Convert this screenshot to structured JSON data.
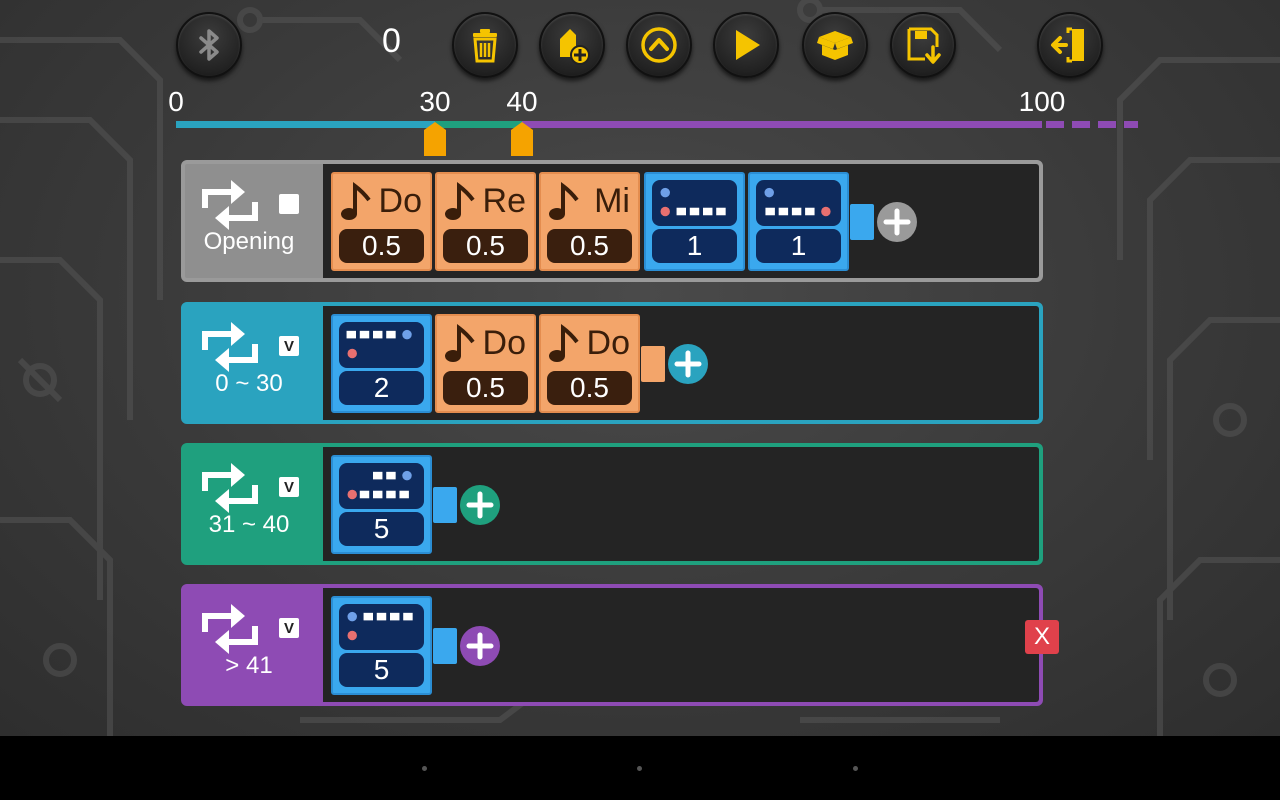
{
  "header": {
    "score": "0",
    "buttons": [
      {
        "name": "bluetooth-button",
        "icon": "bluetooth-icon"
      },
      {
        "name": "trash-button",
        "icon": "trash-icon"
      },
      {
        "name": "add-block-button",
        "icon": "add-block-icon"
      },
      {
        "name": "scroll-up-button",
        "icon": "chevron-up-icon"
      },
      {
        "name": "play-button",
        "icon": "play-icon"
      },
      {
        "name": "open-box-button",
        "icon": "open-box-icon"
      },
      {
        "name": "save-button",
        "icon": "save-icon"
      },
      {
        "name": "exit-button",
        "icon": "exit-door-icon"
      }
    ]
  },
  "scale": {
    "labels": [
      "0",
      "30",
      "40",
      "100"
    ],
    "thresholds": [
      30,
      40
    ],
    "max": 100
  },
  "colors": {
    "accent_yellow": "#f5c400",
    "opening": "#8f8f8f",
    "range1": "#2aa3bf",
    "range2": "#1fa07e",
    "range3": "#8e4bb4",
    "note": "#f3a56a",
    "motor": "#3aa8ee",
    "delete": "#e0414b"
  },
  "rows": [
    {
      "label": "Opening",
      "check": "",
      "blocks": [
        {
          "type": "note",
          "title": "Do",
          "value": "0.5"
        },
        {
          "type": "note",
          "title": "Re",
          "value": "0.5"
        },
        {
          "type": "note",
          "title": "Mi",
          "value": "0.5"
        },
        {
          "type": "motor",
          "icon": "motor-icon",
          "value": "1"
        },
        {
          "type": "motor",
          "icon": "motor-icon",
          "value": "1"
        }
      ]
    },
    {
      "label": "0 ~ 30",
      "check": "V",
      "blocks": [
        {
          "type": "motor",
          "icon": "motor-icon",
          "value": "2"
        },
        {
          "type": "note",
          "title": "Do",
          "value": "0.5"
        },
        {
          "type": "note",
          "title": "Do",
          "value": "0.5"
        }
      ]
    },
    {
      "label": "31 ~ 40",
      "check": "V",
      "blocks": [
        {
          "type": "motor",
          "icon": "motor-icon",
          "value": "5"
        }
      ]
    },
    {
      "label": "> 41",
      "check": "V",
      "blocks": [
        {
          "type": "motor",
          "icon": "motor-icon",
          "value": "5"
        }
      ]
    }
  ],
  "delete_label": "X"
}
